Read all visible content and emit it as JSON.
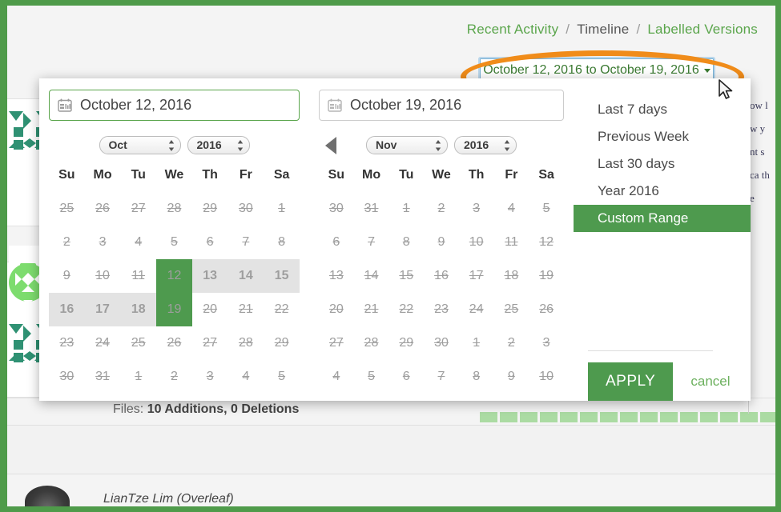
{
  "breadcrumb": {
    "items": [
      {
        "label": "Recent Activity",
        "state": "link"
      },
      {
        "label": "Timeline",
        "state": "current"
      },
      {
        "label": "Labelled Versions",
        "state": "link"
      }
    ],
    "separator": "/"
  },
  "daterange_button": {
    "label": "October 12, 2016 to October 19, 2016",
    "caret": "caret-down-icon",
    "highlight_color": "#f08c1a",
    "focus_color": "#7bb3d6"
  },
  "picker": {
    "start_input": {
      "value": "October 12, 2016",
      "icon": "calendar-icon",
      "active": true
    },
    "end_input": {
      "value": "October 19, 2016",
      "icon": "calendar-icon",
      "active": false
    },
    "left_calendar": {
      "month": "Oct",
      "year": "2016",
      "weekdays": [
        "Su",
        "Mo",
        "Tu",
        "We",
        "Th",
        "Fr",
        "Sa"
      ],
      "weeks": [
        [
          {
            "d": "25",
            "s": "off"
          },
          {
            "d": "26",
            "s": "off"
          },
          {
            "d": "27",
            "s": "off"
          },
          {
            "d": "28",
            "s": "off"
          },
          {
            "d": "29",
            "s": "off"
          },
          {
            "d": "30",
            "s": "off"
          },
          {
            "d": "1",
            "s": "off"
          }
        ],
        [
          {
            "d": "2",
            "s": "off"
          },
          {
            "d": "3",
            "s": "off"
          },
          {
            "d": "4",
            "s": "off"
          },
          {
            "d": "5",
            "s": "off"
          },
          {
            "d": "6",
            "s": "off"
          },
          {
            "d": "7",
            "s": "off"
          },
          {
            "d": "8",
            "s": "off"
          }
        ],
        [
          {
            "d": "9",
            "s": "off"
          },
          {
            "d": "10",
            "s": "off"
          },
          {
            "d": "11",
            "s": "off"
          },
          {
            "d": "12",
            "s": "edge"
          },
          {
            "d": "13",
            "s": "inrange"
          },
          {
            "d": "14",
            "s": "inrange"
          },
          {
            "d": "15",
            "s": "inrange"
          }
        ],
        [
          {
            "d": "16",
            "s": "inrange"
          },
          {
            "d": "17",
            "s": "inrange"
          },
          {
            "d": "18",
            "s": "inrange"
          },
          {
            "d": "19",
            "s": "edge"
          },
          {
            "d": "20",
            "s": "off"
          },
          {
            "d": "21",
            "s": "off"
          },
          {
            "d": "22",
            "s": "off"
          }
        ],
        [
          {
            "d": "23",
            "s": "off"
          },
          {
            "d": "24",
            "s": "off"
          },
          {
            "d": "25",
            "s": "off"
          },
          {
            "d": "26",
            "s": "off"
          },
          {
            "d": "27",
            "s": "off"
          },
          {
            "d": "28",
            "s": "off"
          },
          {
            "d": "29",
            "s": "off"
          }
        ],
        [
          {
            "d": "30",
            "s": "off"
          },
          {
            "d": "31",
            "s": "off"
          },
          {
            "d": "1",
            "s": "off"
          },
          {
            "d": "2",
            "s": "off"
          },
          {
            "d": "3",
            "s": "off"
          },
          {
            "d": "4",
            "s": "off"
          },
          {
            "d": "5",
            "s": "off"
          }
        ]
      ]
    },
    "right_calendar": {
      "month": "Nov",
      "year": "2016",
      "prev_arrow": "triangle-left-icon",
      "weekdays": [
        "Su",
        "Mo",
        "Tu",
        "We",
        "Th",
        "Fr",
        "Sa"
      ],
      "weeks": [
        [
          {
            "d": "30",
            "s": "off"
          },
          {
            "d": "31",
            "s": "off"
          },
          {
            "d": "1",
            "s": "off"
          },
          {
            "d": "2",
            "s": "off"
          },
          {
            "d": "3",
            "s": "off"
          },
          {
            "d": "4",
            "s": "off"
          },
          {
            "d": "5",
            "s": "off"
          }
        ],
        [
          {
            "d": "6",
            "s": "off"
          },
          {
            "d": "7",
            "s": "off"
          },
          {
            "d": "8",
            "s": "off"
          },
          {
            "d": "9",
            "s": "off"
          },
          {
            "d": "10",
            "s": "off"
          },
          {
            "d": "11",
            "s": "off"
          },
          {
            "d": "12",
            "s": "off"
          }
        ],
        [
          {
            "d": "13",
            "s": "off"
          },
          {
            "d": "14",
            "s": "off"
          },
          {
            "d": "15",
            "s": "off"
          },
          {
            "d": "16",
            "s": "off"
          },
          {
            "d": "17",
            "s": "off"
          },
          {
            "d": "18",
            "s": "off"
          },
          {
            "d": "19",
            "s": "off"
          }
        ],
        [
          {
            "d": "20",
            "s": "off"
          },
          {
            "d": "21",
            "s": "off"
          },
          {
            "d": "22",
            "s": "off"
          },
          {
            "d": "23",
            "s": "off"
          },
          {
            "d": "24",
            "s": "off"
          },
          {
            "d": "25",
            "s": "off"
          },
          {
            "d": "26",
            "s": "off"
          }
        ],
        [
          {
            "d": "27",
            "s": "off"
          },
          {
            "d": "28",
            "s": "off"
          },
          {
            "d": "29",
            "s": "off"
          },
          {
            "d": "30",
            "s": "off"
          },
          {
            "d": "1",
            "s": "off"
          },
          {
            "d": "2",
            "s": "off"
          },
          {
            "d": "3",
            "s": "off"
          }
        ],
        [
          {
            "d": "4",
            "s": "off"
          },
          {
            "d": "5",
            "s": "off"
          },
          {
            "d": "6",
            "s": "off"
          },
          {
            "d": "7",
            "s": "off"
          },
          {
            "d": "8",
            "s": "off"
          },
          {
            "d": "9",
            "s": "off"
          },
          {
            "d": "10",
            "s": "off"
          }
        ]
      ]
    },
    "ranges": [
      {
        "label": "Last 7 days",
        "selected": false
      },
      {
        "label": "Previous Week",
        "selected": false
      },
      {
        "label": "Last 30 days",
        "selected": false
      },
      {
        "label": "Year 2016",
        "selected": false
      },
      {
        "label": "Custom Range",
        "selected": true
      }
    ],
    "apply_label": "APPLY",
    "cancel_label": "cancel",
    "accent_color": "#4e9a4e"
  },
  "background": {
    "file_stats_label": "Files:",
    "file_stats_value": "10 Additions, 0 Deletions",
    "author": "LianTze Lim (Overleaf)",
    "diff_block_count": 16,
    "doc_text": "ow l w y nt s ca th e"
  }
}
